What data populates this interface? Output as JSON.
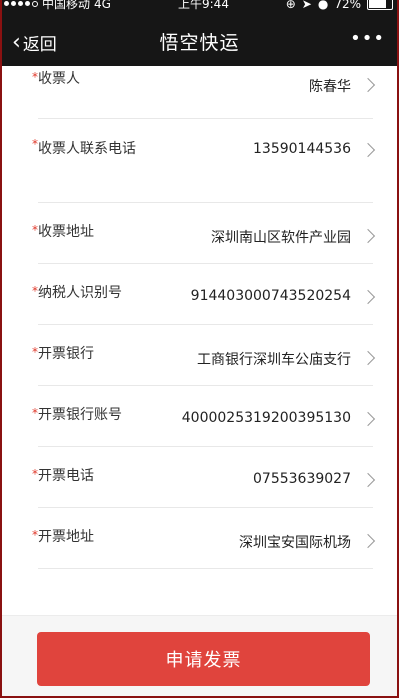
{
  "status_bar": {
    "carrier": "中国移动",
    "network": "4G",
    "time": "上午9:44",
    "battery": "72%",
    "signal_icons": [
      "lock-rotation-icon",
      "location-icon",
      "alarm-icon"
    ]
  },
  "nav": {
    "back_label": "返回",
    "title": "悟空快运",
    "more_label": "•••"
  },
  "form": {
    "required_mark": "*",
    "rows": [
      {
        "label": "收票人",
        "value": "陈春华"
      },
      {
        "label": "收票人联系电话",
        "value": "13590144536"
      },
      {
        "label": "收票地址",
        "value": "深圳南山区软件产业园"
      },
      {
        "label": "纳税人识别号",
        "value": "914403000743520254"
      },
      {
        "label": "开票银行",
        "value": "工商银行深圳车公庙支行"
      },
      {
        "label": "开票银行账号",
        "value": "4000025319200395130"
      },
      {
        "label": "开票电话",
        "value": "07553639027"
      },
      {
        "label": "开票地址",
        "value": "深圳宝安国际机场"
      }
    ]
  },
  "submit_label": "申请发票",
  "colors": {
    "accent": "#e0443d",
    "nav_background": "#161616",
    "required": "#e0392b"
  }
}
